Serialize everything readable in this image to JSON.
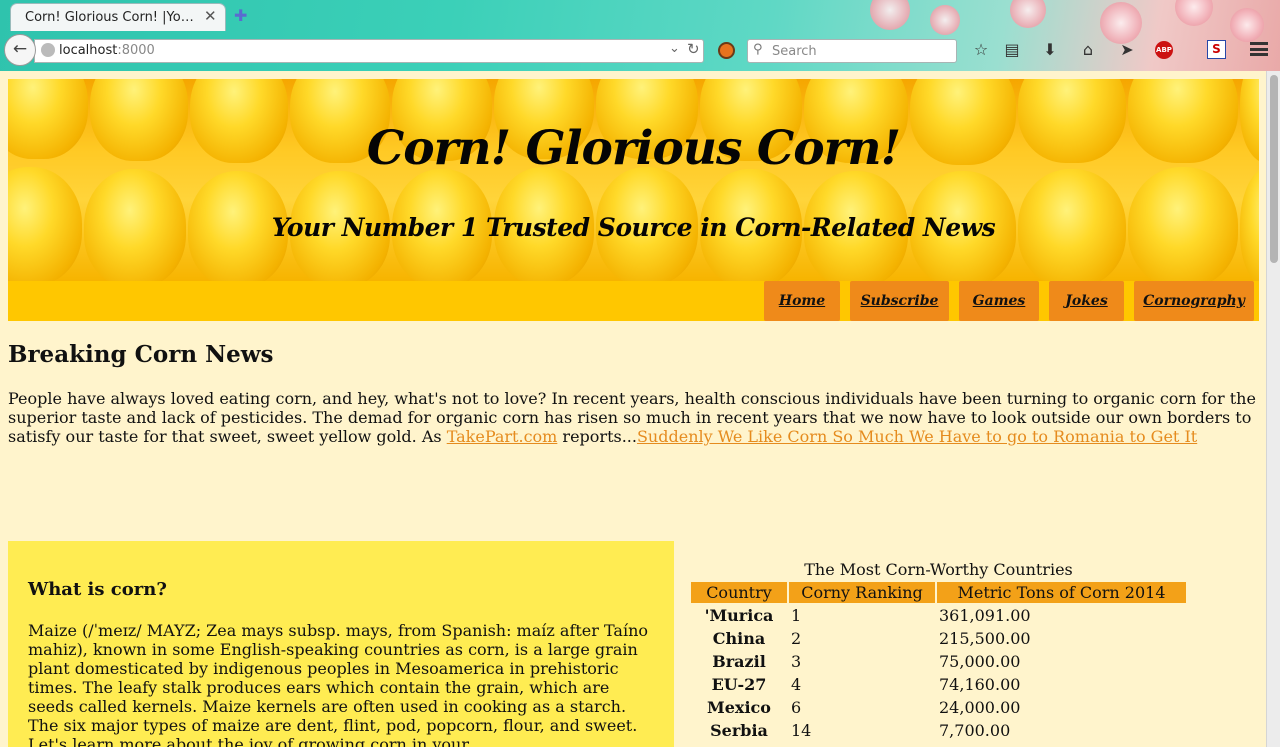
{
  "browser": {
    "tab_title": "Corn! Glorious Corn! |Yo…",
    "tab_close": "✕",
    "new_tab": "✚",
    "url_host": "localhost",
    "url_port": ":8000",
    "search_placeholder": "Search"
  },
  "header": {
    "title": "Corn! Glorious Corn!",
    "subtitle": "Your Number 1 Trusted Source in Corn-Related News"
  },
  "nav": {
    "items": [
      {
        "label": "Home"
      },
      {
        "label": "Subscribe"
      },
      {
        "label": "Games"
      },
      {
        "label": "Jokes"
      },
      {
        "label": "Cornography"
      }
    ]
  },
  "news": {
    "heading": "Breaking Corn News",
    "body_start": "People have always loved eating corn, and hey, what's not to love? In recent years, health conscious individuals have been turning to organic corn for the superior taste and lack of pesticides. The demad for organic corn has risen so much in recent years that we now have to look outside our own borders to satisfy our taste for that sweet, sweet yellow gold. As ",
    "source_link": "TakePart.com",
    "body_mid": " reports...",
    "article_link": "Suddenly We Like Corn So Much We Have to go to Romania to Get It"
  },
  "what_is_corn": {
    "heading": "What is corn?",
    "body": "Maize (/ˈmeɪz/ MAYZ; Zea mays subsp. mays, from Spanish: maíz after Taíno mahiz), known in some English-speaking countries as corn, is a large grain plant domesticated by indigenous peoples in Mesoamerica in prehistoric times. The leafy stalk produces ears which contain the grain, which are seeds called kernels. Maize kernels are often used in cooking as a starch. The six major types of maize are dent, flint, pod, popcorn, flour, and sweet. Let's learn more about the joy of growing corn in your"
  },
  "ranking_table": {
    "caption": "The Most Corn-Worthy Countries",
    "headers": [
      "Country",
      "Corny Ranking",
      "Metric Tons of Corn 2014"
    ],
    "rows": [
      [
        "'Murica",
        "1",
        "361,091.00"
      ],
      [
        "China",
        "2",
        "215,500.00"
      ],
      [
        "Brazil",
        "3",
        "75,000.00"
      ],
      [
        "EU-27",
        "4",
        "74,160.00"
      ],
      [
        "Mexico",
        "6",
        "24,000.00"
      ],
      [
        "Serbia",
        "14",
        "7,700.00"
      ]
    ]
  },
  "colors": {
    "page_bg": "#fff4cc",
    "nav_strip": "#ffc700",
    "nav_button": "#ef8a1a",
    "link": "#e58b1e",
    "info_box": "#ffec52",
    "table_header": "#f3a118"
  }
}
